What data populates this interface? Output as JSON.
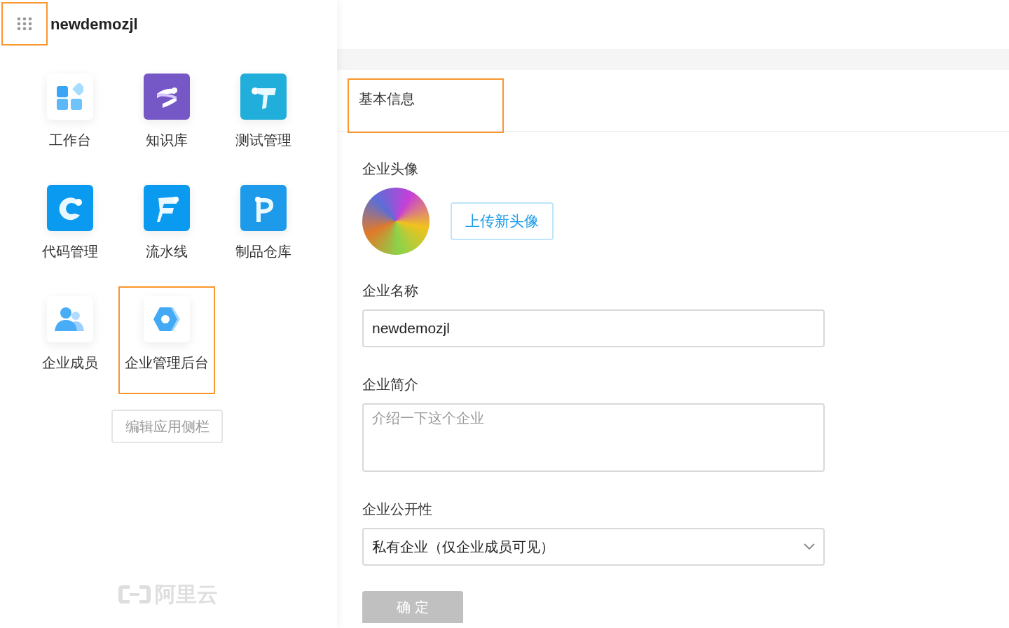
{
  "sidebar": {
    "menu_highlighted": true,
    "org_name": "newdemozjl",
    "apps": [
      {
        "kind": "workbench",
        "label": "工作台",
        "highlighted": false
      },
      {
        "kind": "knowledge",
        "label": "知识库",
        "highlighted": false
      },
      {
        "kind": "testing",
        "label": "测试管理",
        "highlighted": false
      },
      {
        "kind": "code",
        "label": "代码管理",
        "highlighted": false
      },
      {
        "kind": "pipeline",
        "label": "流水线",
        "highlighted": false
      },
      {
        "kind": "artifact",
        "label": "制品仓库",
        "highlighted": false
      },
      {
        "kind": "members",
        "label": "企业成员",
        "highlighted": false
      },
      {
        "kind": "admin",
        "label": "企业管理后台",
        "highlighted": true
      }
    ],
    "edit_button": "编辑应用侧栏",
    "logo_text": "阿里云"
  },
  "main": {
    "tab": {
      "label": "基本信息",
      "highlighted": true
    },
    "avatar": {
      "label": "企业头像",
      "upload_button": "上传新头像"
    },
    "name": {
      "label": "企业名称",
      "value": "newdemozjl"
    },
    "intro": {
      "label": "企业简介",
      "placeholder": "介绍一下这个企业"
    },
    "visibility": {
      "label": "企业公开性",
      "value": "私有企业（仅企业成员可见）"
    },
    "confirm_button": "确 定"
  }
}
